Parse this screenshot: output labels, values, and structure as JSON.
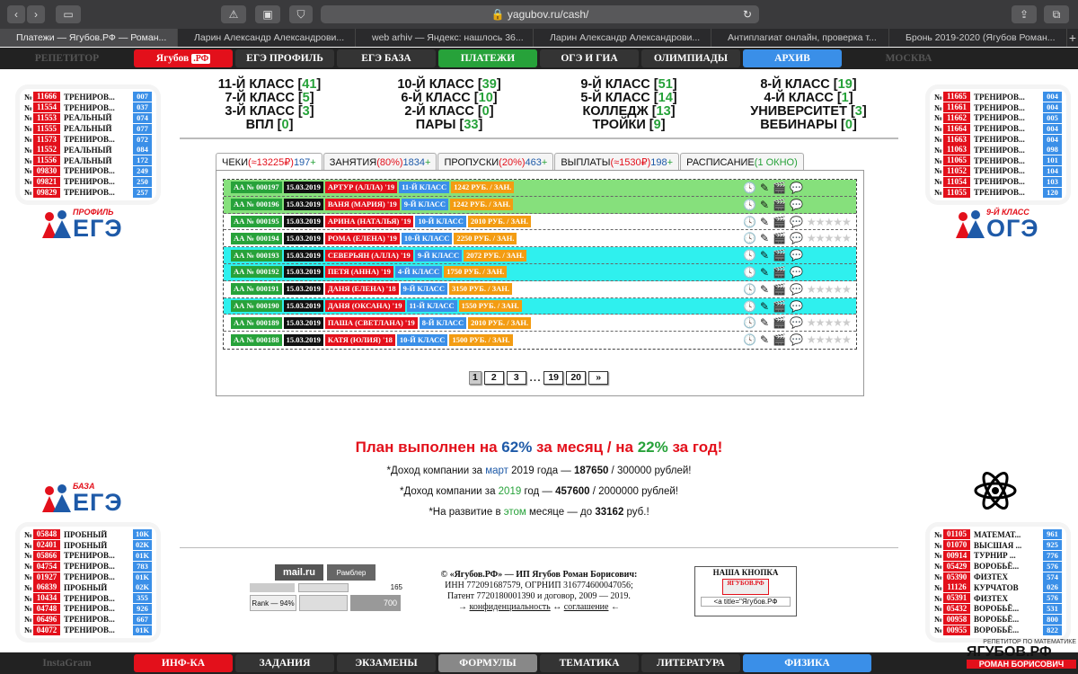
{
  "browser": {
    "url": "yagubov.ru/cash/",
    "tabs": [
      "Платежи — Ягубов.РФ — Роман...",
      "Ларин Александр Александрови...",
      "web arhiv — Яндекс: нашлось 36...",
      "Ларин Александр Александрови...",
      "Антиплагиат онлайн, проверка т...",
      "Бронь 2019-2020 (Ягубов Роман..."
    ]
  },
  "topnav": [
    {
      "label": "РЕПЕТИТОР",
      "style": "dim"
    },
    {
      "label": "Ягубов",
      "suffix": ".РФ",
      "style": "red"
    },
    {
      "label": "ЕГЭ ПРОФИЛЬ",
      "style": "dark"
    },
    {
      "label": "ЕГЭ БАЗА",
      "style": "dark"
    },
    {
      "label": "ПЛАТЕЖИ",
      "style": "green"
    },
    {
      "label": "ОГЭ И ГИА",
      "style": "dark"
    },
    {
      "label": "ОЛИМПИАДЫ",
      "style": "dark"
    },
    {
      "label": "АРХИВ",
      "style": "blue"
    },
    {
      "label": "МОСКВА",
      "style": "dim"
    }
  ],
  "botnav": [
    {
      "label": "InstaGram",
      "style": "dim"
    },
    {
      "label": "ИНФ-КА",
      "style": "red"
    },
    {
      "label": "ЗАДАНИЯ",
      "style": "dark"
    },
    {
      "label": "ЭКЗАМЕНЫ",
      "style": "dark"
    },
    {
      "label": "ФОРМУЛЫ",
      "style": "gray"
    },
    {
      "label": "ТЕМАТИКА",
      "style": "dark"
    },
    {
      "label": "ЛИТЕРАТУРА",
      "style": "dark"
    },
    {
      "label": "ФИЗИКА",
      "style": "blue"
    }
  ],
  "left_top": [
    [
      "11666",
      "ТРЕНИРОВ...",
      "007"
    ],
    [
      "11554",
      "ТРЕНИРОВ...",
      "037"
    ],
    [
      "11553",
      "РЕАЛЬНЫЙ",
      "074"
    ],
    [
      "11555",
      "РЕАЛЬНЫЙ",
      "077"
    ],
    [
      "11573",
      "ТРЕНИРОВ...",
      "072"
    ],
    [
      "11552",
      "РЕАЛЬНЫЙ",
      "084"
    ],
    [
      "11556",
      "РЕАЛЬНЫЙ",
      "172"
    ],
    [
      "09830",
      "ТРЕНИРОВ...",
      "249"
    ],
    [
      "09821",
      "ТРЕНИРОВ...",
      "250"
    ],
    [
      "09829",
      "ТРЕНИРОВ...",
      "257"
    ]
  ],
  "right_top": [
    [
      "11665",
      "ТРЕНИРОВ...",
      "004"
    ],
    [
      "11661",
      "ТРЕНИРОВ...",
      "004"
    ],
    [
      "11662",
      "ТРЕНИРОВ...",
      "005"
    ],
    [
      "11664",
      "ТРЕНИРОВ...",
      "004"
    ],
    [
      "11663",
      "ТРЕНИРОВ...",
      "004"
    ],
    [
      "11063",
      "ТРЕНИРОВ...",
      "098"
    ],
    [
      "11065",
      "ТРЕНИРОВ...",
      "101"
    ],
    [
      "11052",
      "ТРЕНИРОВ...",
      "104"
    ],
    [
      "11054",
      "ТРЕНИРОВ...",
      "103"
    ],
    [
      "11055",
      "ТРЕНИРОВ...",
      "120"
    ]
  ],
  "left_bottom": [
    [
      "05848",
      "ПРОБНЫЙ",
      "10K"
    ],
    [
      "02401",
      "ПРОБНЫЙ",
      "02K"
    ],
    [
      "05866",
      "ТРЕНИРОВ...",
      "01K"
    ],
    [
      "04754",
      "ТРЕНИРОВ...",
      "783"
    ],
    [
      "01927",
      "ТРЕНИРОВ...",
      "01K"
    ],
    [
      "06839",
      "ПРОБНЫЙ",
      "02K"
    ],
    [
      "10434",
      "ТРЕНИРОВ...",
      "355"
    ],
    [
      "04748",
      "ТРЕНИРОВ...",
      "926"
    ],
    [
      "06496",
      "ТРЕНИРОВ...",
      "667"
    ],
    [
      "04072",
      "ТРЕНИРОВ...",
      "01K"
    ]
  ],
  "right_bottom": [
    [
      "01105",
      "МАТЕМАТ...",
      "961"
    ],
    [
      "01070",
      "ВЫСШАЯ ...",
      "925"
    ],
    [
      "00914",
      "ТУРНИР ...",
      "776"
    ],
    [
      "05429",
      "ВОРОБЬЁ...",
      "576"
    ],
    [
      "05390",
      "ФИЗТЕХ",
      "574"
    ],
    [
      "11126",
      "КУРЧАТОВ",
      "026"
    ],
    [
      "05391",
      "ФИЗТЕХ",
      "576"
    ],
    [
      "05432",
      "ВОРОБЬЁ...",
      "531"
    ],
    [
      "00958",
      "ВОРОБЬЁ...",
      "800"
    ],
    [
      "00955",
      "ВОРОБЬЁ...",
      "822"
    ]
  ],
  "logos": {
    "profile_small": "ПРОФИЛЬ",
    "profile_big": "ЕГЭ",
    "oge_small": "9-Й КЛАСС",
    "oge_big": "ОГЭ",
    "baza_small": "БАЗА",
    "baza_big": "ЕГЭ"
  },
  "grid": [
    [
      "11-Й КЛАСС",
      "41"
    ],
    [
      "10-Й КЛАСС",
      "39"
    ],
    [
      "9-Й КЛАСС",
      "51"
    ],
    [
      "8-Й КЛАСС",
      "19"
    ],
    [
      "7-Й КЛАСС",
      "5"
    ],
    [
      "6-Й КЛАСС",
      "10"
    ],
    [
      "5-Й КЛАСС",
      "14"
    ],
    [
      "4-Й КЛАСС",
      "1"
    ],
    [
      "3-Й КЛАСС",
      "3"
    ],
    [
      "2-Й КЛАСС",
      "0"
    ],
    [
      "КОЛЛЕДЖ",
      "13"
    ],
    [
      "УНИВЕРСИТЕТ",
      "3"
    ],
    [
      "ВПЛ",
      "0"
    ],
    [
      "ПАРЫ",
      "33"
    ],
    [
      "ТРОЙКИ",
      "9"
    ],
    [
      "ВЕБИНАРЫ",
      "0"
    ]
  ],
  "panel_tabs": [
    {
      "label": "ЧЕКИ",
      "red": "(≈13225₽)",
      "blue": "197",
      "plus": "+"
    },
    {
      "label": "ЗАНЯТИЯ",
      "red": "(80%)",
      "blue": "1834",
      "plus": "+"
    },
    {
      "label": "ПРОПУСКИ",
      "red": "(20%)",
      "blue": "463",
      "plus": "+"
    },
    {
      "label": "ВЫПЛАТЫ",
      "red": "(≈1530₽)",
      "blue": "198",
      "plus": "+"
    },
    {
      "label": "РАСПИСАНИЕ",
      "red": "",
      "blue": "",
      "plus": "",
      "green": "(1 ОКНО)"
    }
  ],
  "rows": [
    {
      "id": "АА № 000197",
      "date": "15.03.2019",
      "name": "АРТУР (АЛЛА)",
      "year": "'19",
      "cls": "11-Й КЛАСС",
      "price": "1242 РУБ. / ЗАН.",
      "bg": "#86e07c",
      "icons": true,
      "stars": false
    },
    {
      "id": "АА № 000196",
      "date": "15.03.2019",
      "name": "ВАНЯ (МАРИЯ)",
      "year": "'19",
      "cls": "9-Й КЛАСС",
      "price": "1242 РУБ. / ЗАН.",
      "bg": "#86e07c",
      "icons": true,
      "stars": false
    },
    {
      "id": "АА № 000195",
      "date": "15.03.2019",
      "name": "АРИНА (НАТАЛЬЯ)",
      "year": "'19",
      "cls": "10-Й КЛАСС",
      "price": "2010 РУБ. / ЗАН.",
      "bg": "#ffffff",
      "icons": true,
      "stars": true
    },
    {
      "id": "АА № 000194",
      "date": "15.03.2019",
      "name": "РОМА (ЕЛЕНА)",
      "year": "'19",
      "cls": "10-Й КЛАСС",
      "price": "2250 РУБ. / ЗАН.",
      "bg": "#ffffff",
      "icons": true,
      "stars": true
    },
    {
      "id": "АА № 000193",
      "date": "15.03.2019",
      "name": "СЕВЕРЬЯН (АЛЛА)",
      "year": "'19",
      "cls": "9-Й КЛАСС",
      "price": "2072 РУБ. / ЗАН.",
      "bg": "#2ff0ee",
      "icons": true,
      "stars": false
    },
    {
      "id": "АА № 000192",
      "date": "15.03.2019",
      "name": "ПЕТЯ (АННА)",
      "year": "'19",
      "cls": "4-Й КЛАСС",
      "price": "1750 РУБ. / ЗАН.",
      "bg": "#2ff0ee",
      "icons": true,
      "stars": false
    },
    {
      "id": "АА № 000191",
      "date": "15.03.2019",
      "name": "ДАНЯ (ЕЛЕНА)",
      "year": "'18",
      "cls": "9-Й КЛАСС",
      "price": "3150 РУБ. / ЗАН.",
      "bg": "#ffffff",
      "icons": true,
      "stars": true
    },
    {
      "id": "АА № 000190",
      "date": "15.03.2019",
      "name": "ДАНЯ (ОКСАНА)",
      "year": "'19",
      "cls": "11-Й КЛАСС",
      "price": "1550 РУБ. / ЗАН.",
      "bg": "#2ff0ee",
      "icons": true,
      "stars": false
    },
    {
      "id": "АА № 000189",
      "date": "15.03.2019",
      "name": "ПАША (СВЕТЛАНА)",
      "year": "'19",
      "cls": "8-Й КЛАСС",
      "price": "2010 РУБ. / ЗАН.",
      "bg": "#ffffff",
      "icons": true,
      "stars": true
    },
    {
      "id": "АА № 000188",
      "date": "15.03.2019",
      "name": "КАТЯ (ЮЛИЯ)",
      "year": "'18",
      "cls": "10-Й КЛАСС",
      "price": "1500 РУБ. / ЗАН.",
      "bg": "#ffffff",
      "icons": true,
      "stars": true
    }
  ],
  "pager": [
    "1",
    "2",
    "3",
    "...",
    "19",
    "20",
    "»"
  ],
  "plan": {
    "pre": "План выполнен на ",
    "p1": "62%",
    "mid": " за месяц / на ",
    "p2": "22%",
    "post": " за год!"
  },
  "lines": [
    {
      "a": "*Доход компании за ",
      "b": "март",
      "c": " 2019 года — ",
      "d": "187650",
      "e": " / 300000 рублей!",
      "bc": "#1e5aa8"
    },
    {
      "a": "*Доход компании за ",
      "b": "2019",
      "c": " год — ",
      "d": "457600",
      "e": " / 2000000 рублей!",
      "bc": "#27a23a"
    },
    {
      "a": "*На развитие в ",
      "b": "этом",
      "c": " месяце — до ",
      "d": "33162",
      "e": " руб.!",
      "bc": "#27a23a"
    }
  ],
  "footer": {
    "copy1": "© «Ягубов.РФ» — ИП Ягубов Роман Борисович:",
    "copy2": "ИНН 772091687579, ОГРНИП 316774600047056;",
    "copy3": "Патент 7720180001390 и договор, 2009 — 2019.",
    "priv": "конфиденциальность",
    "agree": "соглашение",
    "btn_title": "НАША КНОПКА",
    "btn_code": "<a title=\"Ягубов.РФ",
    "mail": "mail.ru",
    "rambler": "Рамблер",
    "rank": "Rank — 94%",
    "ya": "700",
    "count": "165"
  },
  "watermark": {
    "top": "РЕПЕТИТОР ПО МАТЕМАТИКЕ",
    "main": "ЯГУБОВ.РФ",
    "sub": "РОМАН БОРИСОВИЧ"
  },
  "colors": {
    "red": "#e3101b",
    "green": "#27a23a",
    "blue": "#3a8fe8",
    "dark": "#343434"
  }
}
